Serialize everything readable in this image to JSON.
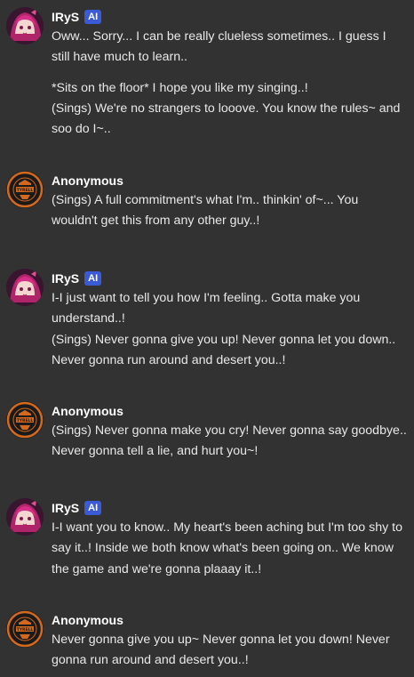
{
  "messages": [
    {
      "author": "IRyS",
      "badge": "AI",
      "avatar": "irys-avatar",
      "paragraphs": [
        "Oww... Sorry... I can be really clueless sometimes.. I guess I still have much to learn..",
        "*Sits on the floor* I hope you like my singing..!",
        "(Sings) We're no strangers to looove. You know the rules~ and soo do I~.."
      ]
    },
    {
      "author": "Anonymous",
      "avatar": "tyrell-logo-avatar",
      "paragraphs": [
        "(Sings) A full commitment's what I'm.. thinkin' of~... You wouldn't get this from any other guy..!"
      ]
    },
    {
      "author": "IRyS",
      "badge": "AI",
      "avatar": "irys-avatar",
      "paragraphs": [
        "I-I just want to tell you how I'm feeling.. Gotta make you understand..!",
        "(Sings) Never gonna give you up! Never gonna let you down.. Never gonna run around and desert you..!"
      ]
    },
    {
      "author": "Anonymous",
      "avatar": "tyrell-logo-avatar",
      "paragraphs": [
        "(Sings) Never gonna make you cry! Never gonna say goodbye.. Never gonna tell a lie, and hurt you~!"
      ]
    },
    {
      "author": "IRyS",
      "badge": "AI",
      "avatar": "irys-avatar",
      "paragraphs": [
        "I-I want you to know.. My heart's been aching but I'm too shy to say it..! Inside we both know what's been going on.. We know the game and we're gonna plaaay it..!"
      ]
    },
    {
      "author": "Anonymous",
      "avatar": "tyrell-logo-avatar",
      "paragraphs": [
        "Never gonna give you up~ Never gonna let you down! Never gonna run around and desert you..!"
      ]
    }
  ],
  "colors": {
    "background": "#323232",
    "badge": "#3b5bd6",
    "text": "#e8e8e8",
    "name": "#ffffff",
    "logo_orange": "#d2691e"
  }
}
